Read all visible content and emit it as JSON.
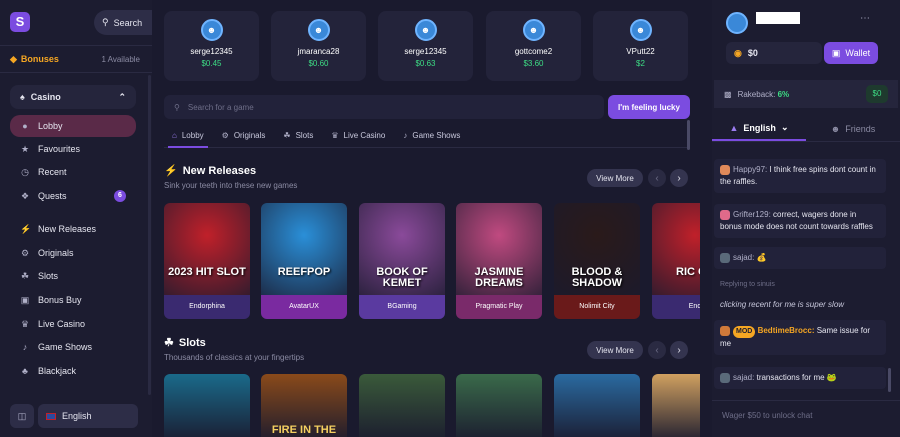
{
  "sidebar": {
    "logo": "S",
    "search_label": "Search",
    "bonuses_label": "Bonuses",
    "bonuses_available": "1 Available",
    "casino_label": "Casino",
    "items": [
      {
        "label": "Lobby",
        "icon": "user-icon"
      },
      {
        "label": "Favourites",
        "icon": "star-icon"
      },
      {
        "label": "Recent",
        "icon": "clock-icon"
      },
      {
        "label": "Quests",
        "icon": "quests-icon",
        "badge": "6"
      },
      {
        "label": "New Releases",
        "icon": "bolt-icon"
      },
      {
        "label": "Originals",
        "icon": "gear-icon"
      },
      {
        "label": "Slots",
        "icon": "cherry-icon"
      },
      {
        "label": "Bonus Buy",
        "icon": "bag-icon"
      },
      {
        "label": "Live Casino",
        "icon": "crown-icon"
      },
      {
        "label": "Game Shows",
        "icon": "mic-icon"
      },
      {
        "label": "Blackjack",
        "icon": "cards-icon"
      }
    ],
    "language": "English"
  },
  "winners": [
    {
      "name": "serge12345",
      "amount": "$0.45"
    },
    {
      "name": "jmaranca28",
      "amount": "$0.60"
    },
    {
      "name": "serge12345",
      "amount": "$0.63"
    },
    {
      "name": "gottcome2",
      "amount": "$3.60"
    },
    {
      "name": "VPutt22",
      "amount": "$2"
    }
  ],
  "search": {
    "placeholder": "Search for a game"
  },
  "lucky_button": "I'm feeling lucky",
  "tabs": [
    {
      "label": "Lobby",
      "icon": "house-icon"
    },
    {
      "label": "Originals",
      "icon": "gear-icon"
    },
    {
      "label": "Slots",
      "icon": "cherry-icon"
    },
    {
      "label": "Live Casino",
      "icon": "crown-icon"
    },
    {
      "label": "Game Shows",
      "icon": "mic-icon"
    }
  ],
  "new_releases": {
    "title": "New Releases",
    "subtitle": "Sink your teeth into these new games",
    "view_more": "View More",
    "games": [
      {
        "title": "2023 HIT SLOT",
        "provider": "Endorphina",
        "color": "#c0202a",
        "footer": "#3a2a70"
      },
      {
        "title": "REEFPOP",
        "provider": "AvatarUX",
        "color": "#2a8fd8",
        "footer": "#7a2aa0"
      },
      {
        "title": "BOOK OF KEMET",
        "provider": "BGaming",
        "color": "#8a4a9a",
        "footer": "#5a3aa0"
      },
      {
        "title": "JASMINE DREAMS",
        "provider": "Pragmatic Play",
        "color": "#c04a80",
        "footer": "#7a2a6a"
      },
      {
        "title": "BLOOD & SHADOW",
        "provider": "Nolimit City",
        "color": "#2a1a1a",
        "footer": "#6a1a1a"
      },
      {
        "title": "RIC\nCA",
        "provider": "End",
        "color": "#c0202a",
        "footer": "#3a2a70"
      }
    ]
  },
  "slots": {
    "title": "Slots",
    "subtitle": "Thousands of classics at your fingertips",
    "view_more": "View More",
    "games": [
      {
        "color": "#1a6a8a"
      },
      {
        "color": "#8a4a1a",
        "title": "FIRE IN THE"
      },
      {
        "color": "#3a5a3a"
      },
      {
        "color": "#3a6a4a"
      },
      {
        "color": "#2a6aa0"
      },
      {
        "color": "#d0a060"
      }
    ]
  },
  "right": {
    "balance": "$0",
    "wallet": "Wallet",
    "rakeback_label": "Rakeback:",
    "rakeback_value": "6%",
    "rakeback_amount": "$0",
    "chat_tab": "English",
    "friends_tab": "Friends",
    "messages": [
      {
        "user": "Happy97:",
        "text": "I think free spins dont count in the raffles.",
        "color": "#e08a5a"
      },
      {
        "user": "Grifter129:",
        "text": "correct, wagers done in bonus mode does not count towards raffles",
        "color": "#e06a8a"
      },
      {
        "user": "sajad:",
        "text": "💰",
        "color": "#5a6a7a"
      },
      {
        "user": "BedtimeBrocc:",
        "badge": "MOD",
        "text": "Same issue for me",
        "color": "#d07a3a"
      },
      {
        "user": "sajad:",
        "text": "transactions for me 🐸",
        "color": "#5a6a7a"
      }
    ],
    "reply_label": "Replying to sinuis",
    "reply_text": "clicking recent for me is super slow",
    "input_placeholder": "Wager $50 to unlock chat"
  }
}
